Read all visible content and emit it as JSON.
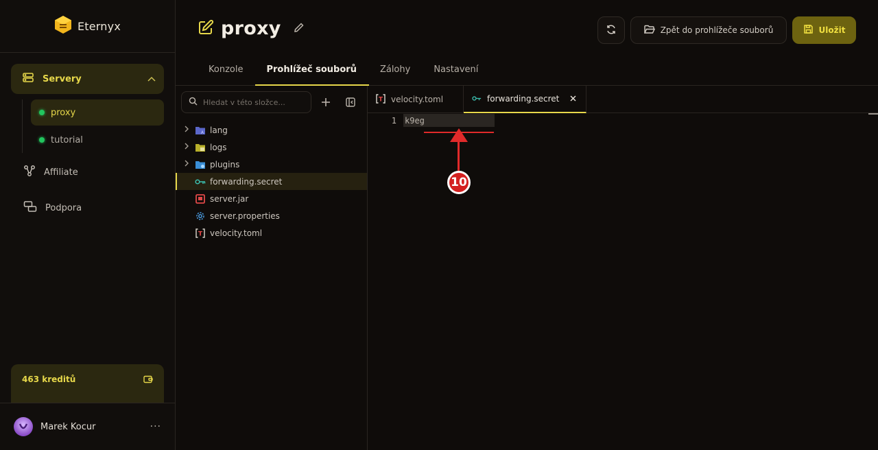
{
  "brand": {
    "name": "Eternyx"
  },
  "sidebar": {
    "group": {
      "label": "Servery",
      "icon": "server-icon"
    },
    "servers": [
      {
        "label": "proxy",
        "status": "online",
        "active": true
      },
      {
        "label": "tutorial",
        "status": "online",
        "active": false
      }
    ],
    "items": [
      {
        "label": "Affiliate",
        "icon": "affiliate-icon"
      },
      {
        "label": "Podpora",
        "icon": "support-icon"
      }
    ],
    "credits": {
      "label": "463 kreditů"
    },
    "user": {
      "name": "Marek Kocur",
      "more": "···"
    }
  },
  "header": {
    "title": "proxy",
    "actions": {
      "back_label": "Zpět do prohlížeče souborů",
      "save_label": "Uložit"
    },
    "tabs": [
      {
        "label": "Konzole"
      },
      {
        "label": "Prohlížeč souborů"
      },
      {
        "label": "Zálohy"
      },
      {
        "label": "Nastavení"
      }
    ]
  },
  "filepanel": {
    "search_placeholder": "Hledat v této složce...",
    "tree": [
      {
        "name": "lang",
        "type": "folder"
      },
      {
        "name": "logs",
        "type": "folder"
      },
      {
        "name": "plugins",
        "type": "folder"
      },
      {
        "name": "forwarding.secret",
        "type": "key-file"
      },
      {
        "name": "server.jar",
        "type": "jar-file"
      },
      {
        "name": "server.properties",
        "type": "gear-file"
      },
      {
        "name": "velocity.toml",
        "type": "toml-file"
      }
    ]
  },
  "editor": {
    "tabs": [
      {
        "label": "velocity.toml"
      },
      {
        "label": "forwarding.secret"
      }
    ],
    "line_number": "1",
    "line_text": "k9eg"
  },
  "annotation": {
    "number": "10"
  },
  "colors": {
    "accent": "#e7d84a",
    "annotation": "#e02a2a",
    "online": "#22c55e"
  }
}
